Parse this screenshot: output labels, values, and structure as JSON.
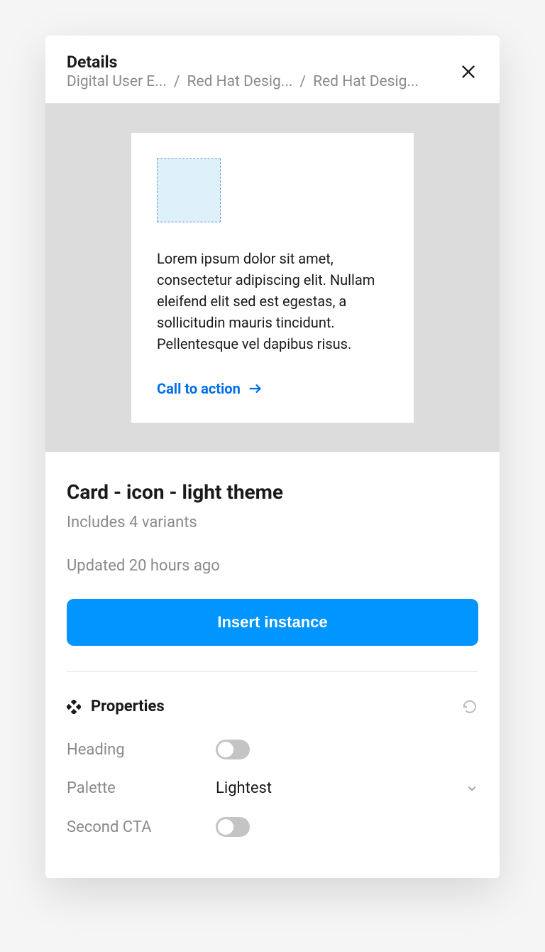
{
  "header": {
    "title": "Details",
    "breadcrumb": {
      "item1": "Digital User E...",
      "item2": "Red Hat Desig...",
      "item3": "Red Hat Desig..."
    }
  },
  "preview": {
    "body_text": "Lorem ipsum dolor sit amet, consectetur adipiscing elit. Nullam eleifend elit sed est egestas, a sollicitudin mauris tincidunt. Pellentesque vel dapibus risus.",
    "cta_label": "Call to action"
  },
  "details": {
    "component_title": "Card - icon - light theme",
    "variants_text": "Includes 4 variants",
    "updated_text": "Updated 20 hours ago",
    "insert_button": "Insert instance"
  },
  "properties": {
    "section_title": "Properties",
    "heading_label": "Heading",
    "palette_label": "Palette",
    "palette_value": "Lightest",
    "second_cta_label": "Second CTA"
  }
}
